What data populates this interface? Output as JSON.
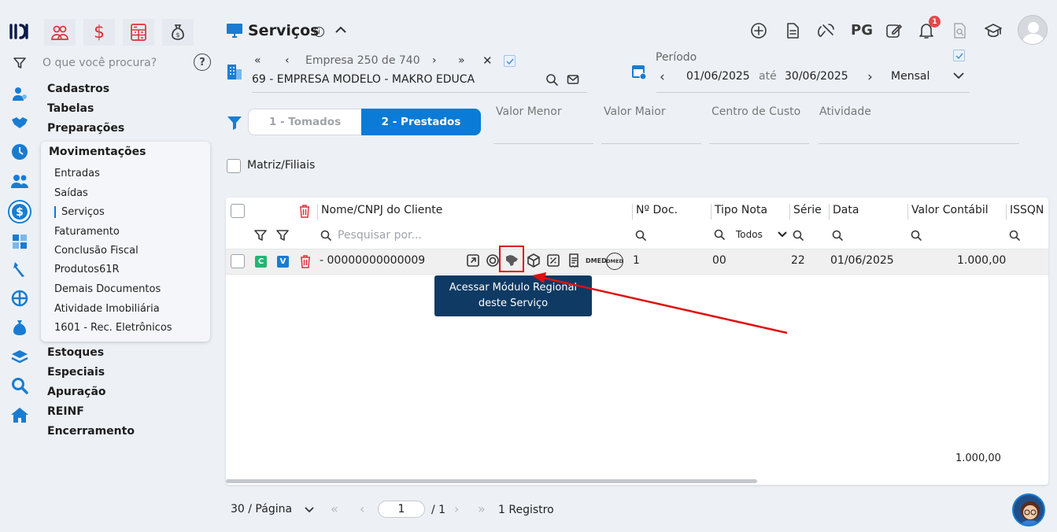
{
  "search": {
    "placeholder": "O que você procura?"
  },
  "menu": {
    "main_top": [
      "Cadastros",
      "Tabelas",
      "Preparações"
    ],
    "open_section": "Movimentações",
    "sub_items": [
      "Entradas",
      "Saídas",
      "Serviços",
      "Faturamento",
      "Conclusão Fiscal",
      "Produtos61R",
      "Demais Documentos",
      "Atividade Imobiliária",
      "1601 - Rec. Eletrônicos"
    ],
    "main_bottom": [
      "Estoques",
      "Especiais",
      "Apuração",
      "REINF",
      "Encerramento"
    ]
  },
  "header": {
    "title": "Serviços",
    "empresa_nav": "Empresa 250 de 740",
    "empresa_name": "69 - EMPRESA MODELO - MAKRO EDUCA",
    "periodo_label": "Período",
    "date_from": "01/06/2025",
    "ate": "até",
    "date_to": "30/06/2025",
    "period_type": "Mensal",
    "pg_label": "PG",
    "notification_count": "1"
  },
  "filters": {
    "tab1": "1 - Tomados",
    "tab2": "2 - Prestados",
    "valor_menor": "Valor Menor",
    "valor_maior": "Valor Maior",
    "centro_custo": "Centro de Custo",
    "atividade": "Atividade",
    "matriz_filiais": "Matriz/Filiais"
  },
  "table": {
    "columns": [
      "Nome/CNPJ do Cliente",
      "Nº Doc.",
      "Tipo Nota",
      "Série",
      "Data",
      "Valor Contábil",
      "ISSQN"
    ],
    "search_placeholder": "Pesquisar por...",
    "tipo_nota_filter": "Todos",
    "row": {
      "badge_c": "C",
      "badge_v": "V",
      "cliente": "- 00000000000009",
      "doc": "1",
      "tipo": "00",
      "serie": "22",
      "data": "01/06/2025",
      "valor": "1.000,00",
      "dmed1": "DMED",
      "dmed2": "DMED"
    },
    "total": "1.000,00"
  },
  "tooltip": "Acessar Módulo Regional deste Serviço",
  "pagination": {
    "per_page": "30 / Página",
    "page": "1",
    "of": "/ 1",
    "records": "1 Registro"
  },
  "colors": {
    "accent": "#0a7bd6",
    "tooltip_bg": "#0f3a63",
    "highlight": "#e01010",
    "tab_active": "#0a7bd6"
  }
}
